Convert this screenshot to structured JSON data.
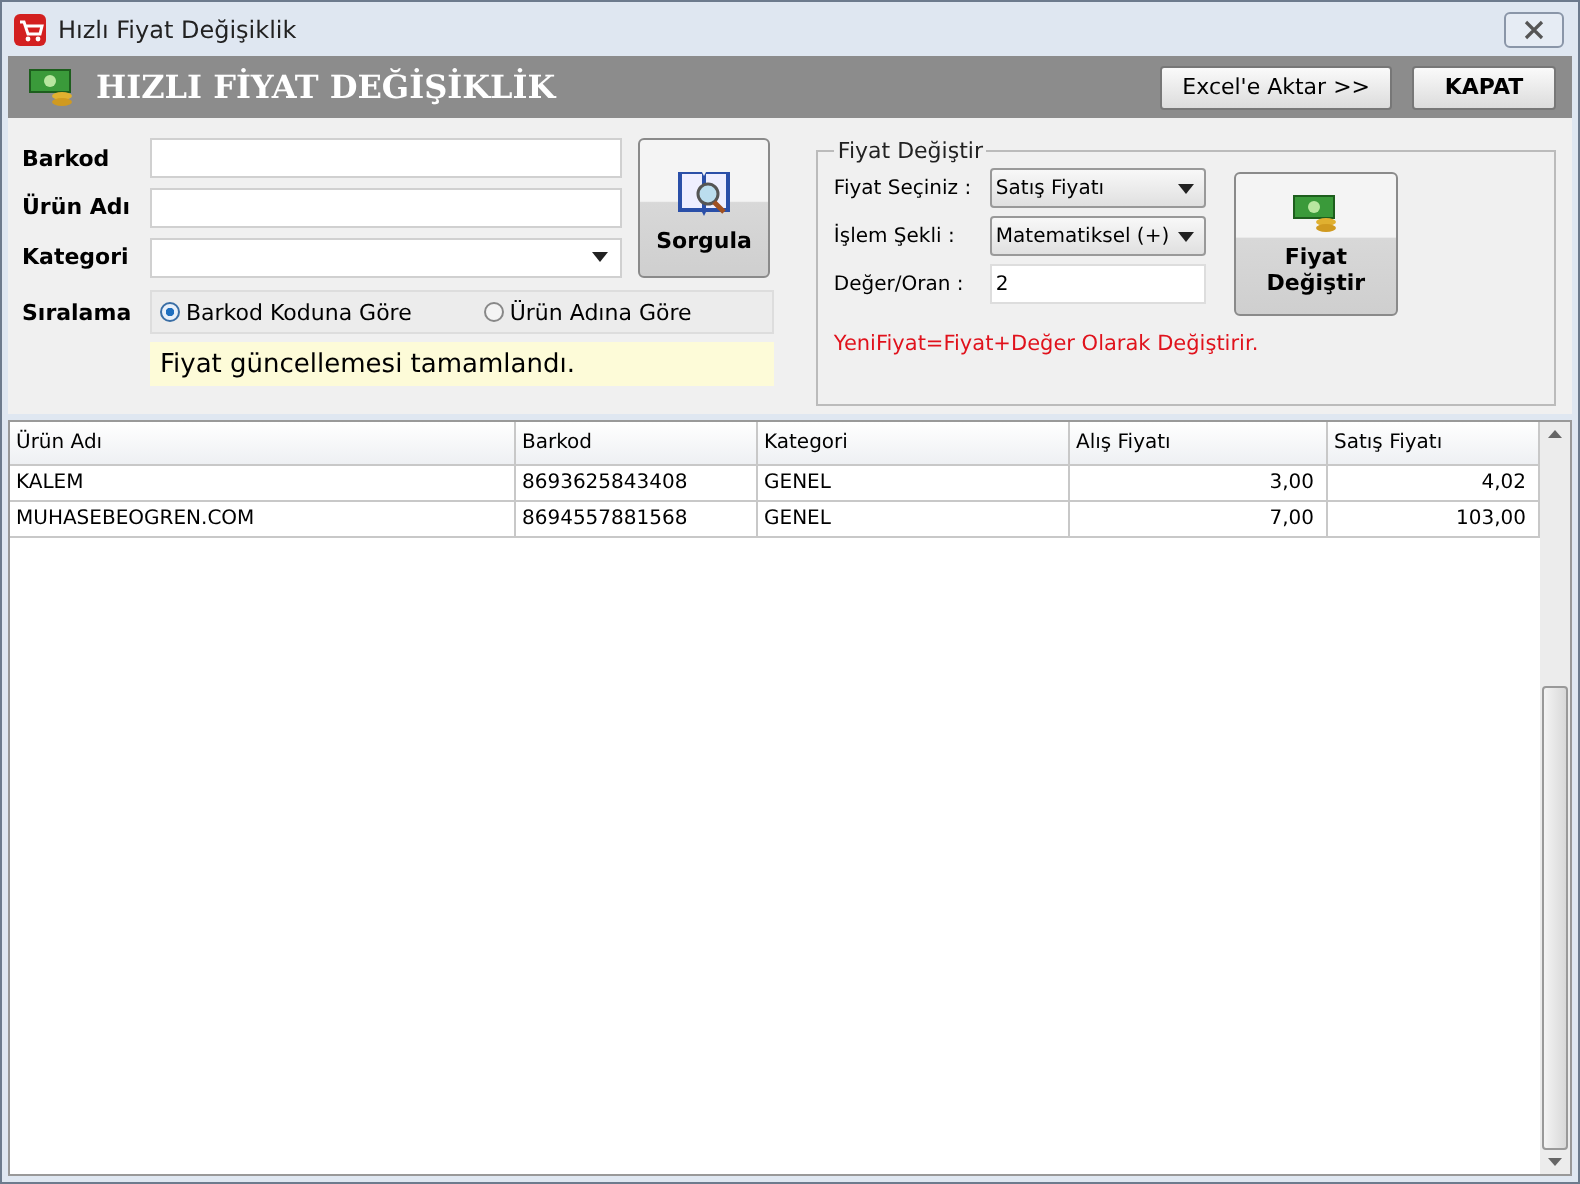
{
  "window": {
    "title": "Hızlı Fiyat Değişiklik"
  },
  "header": {
    "title": "HIZLI FİYAT DEĞİŞİKLİK",
    "buttons": [
      "Excel'e Aktar >>",
      "KAPAT"
    ]
  },
  "search": {
    "fields": [
      {
        "label": "Barkod",
        "kind": "text"
      },
      {
        "label": "Ürün Adı",
        "kind": "text"
      },
      {
        "label": "Kategori",
        "kind": "dropdown"
      }
    ],
    "button": "Sorgula",
    "sorting": {
      "label": "Sıralama",
      "options": [
        {
          "label": "Barkod Koduna  Göre",
          "selected": true
        },
        {
          "label": "Ürün Adına Göre",
          "selected": false
        }
      ]
    },
    "message": "Fiyat güncellemesi tamamlandı."
  },
  "price_change": {
    "title": "Fiyat Değiştir",
    "fields": [
      {
        "label": "Fiyat Seçiniz :",
        "kind": "dropdown",
        "value": "Satış Fiyatı"
      },
      {
        "label": "İşlem Şekli :",
        "kind": "dropdown",
        "value": "Matematiksel (+)"
      },
      {
        "label": "Değer/Oran :",
        "kind": "text",
        "value": "2"
      }
    ],
    "button": "Fiyat Değiştir",
    "formula": "YeniFiyat=Fiyat+Değer Olarak Değiştirir."
  },
  "table": {
    "columns": [
      "Ürün Adı",
      "Barkod",
      "Kategori",
      "Alış Fiyatı",
      "Satış Fiyatı"
    ],
    "rows": [
      [
        "KALEM",
        "8693625843408",
        "GENEL",
        "3,00",
        "4,02"
      ],
      [
        "MUHASEBEOGREN.COM",
        "8694557881568",
        "GENEL",
        "7,00",
        "103,00"
      ]
    ]
  }
}
